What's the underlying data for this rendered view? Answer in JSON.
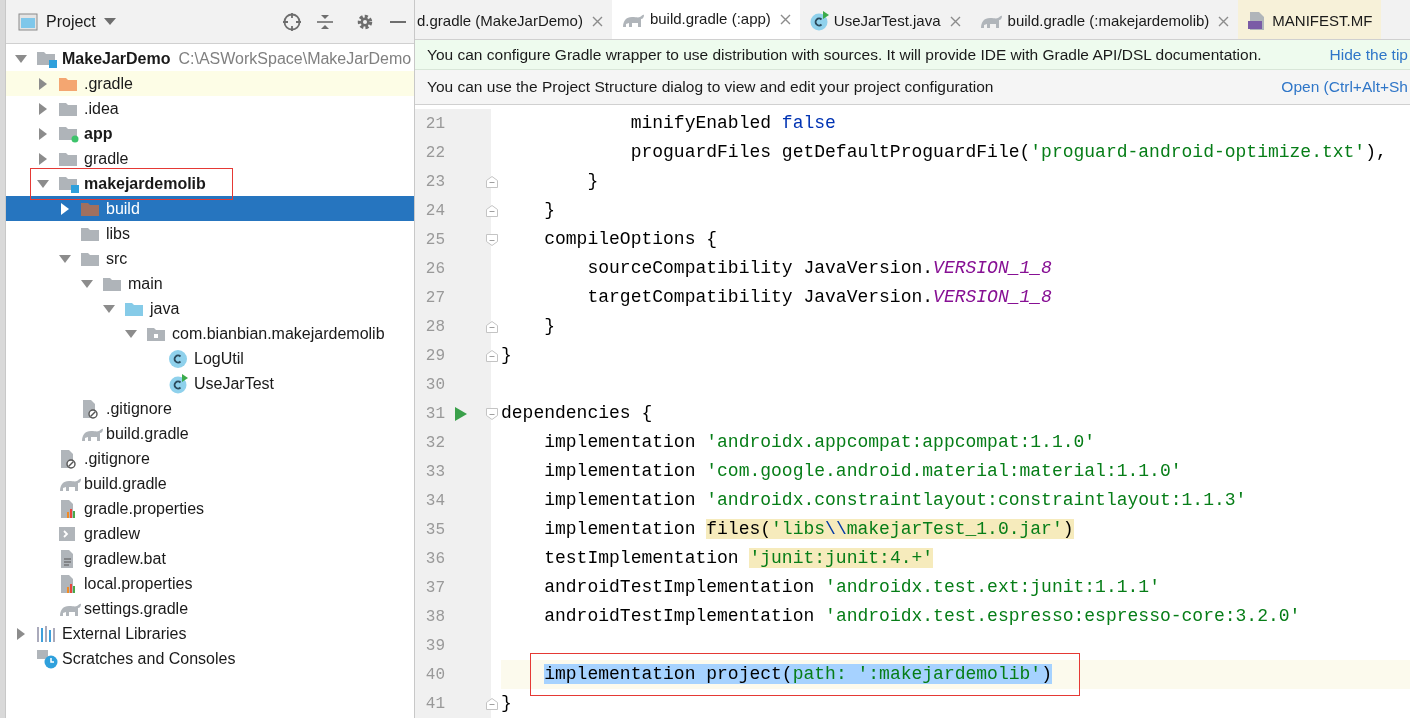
{
  "project_panel": {
    "title": "Project",
    "tree": [
      {
        "label": "MakeJarDemo",
        "hint": "C:\\ASWorkSpace\\MakeJarDemo",
        "kind": "module",
        "bold": true,
        "expanded": true,
        "selected": false,
        "children": [
          {
            "label": ".gradle",
            "kind": "folder-orange",
            "expanded": false,
            "selected": false,
            "highlighted": true
          },
          {
            "label": ".idea",
            "kind": "folder",
            "expanded": false,
            "selected": false
          },
          {
            "label": "app",
            "kind": "module-app",
            "bold": true,
            "expanded": false,
            "selected": false
          },
          {
            "label": "gradle",
            "kind": "folder",
            "expanded": false,
            "selected": false
          },
          {
            "label": "makejardemolib",
            "kind": "module",
            "bold": true,
            "expanded": true,
            "selected": false,
            "annotated": true,
            "children": [
              {
                "label": "build",
                "kind": "folder-build",
                "expanded": false,
                "selected": true
              },
              {
                "label": "libs",
                "kind": "folder",
                "selected": false
              },
              {
                "label": "src",
                "kind": "folder",
                "expanded": true,
                "selected": false,
                "children": [
                  {
                    "label": "main",
                    "kind": "folder",
                    "expanded": true,
                    "selected": false,
                    "children": [
                      {
                        "label": "java",
                        "kind": "folder-source",
                        "expanded": true,
                        "selected": false,
                        "children": [
                          {
                            "label": "com.bianbian.makejardemolib",
                            "kind": "package",
                            "expanded": true,
                            "selected": false,
                            "children": [
                              {
                                "label": "LogUtil",
                                "kind": "class",
                                "selected": false
                              },
                              {
                                "label": "UseJarTest",
                                "kind": "class-run",
                                "selected": false
                              }
                            ]
                          }
                        ]
                      }
                    ]
                  }
                ]
              },
              {
                "label": ".gitignore",
                "kind": "ignore-file",
                "selected": false
              },
              {
                "label": "build.gradle",
                "kind": "gradle",
                "selected": false
              }
            ]
          },
          {
            "label": ".gitignore",
            "kind": "ignore-file",
            "selected": false
          },
          {
            "label": "build.gradle",
            "kind": "gradle",
            "selected": false
          },
          {
            "label": "gradle.properties",
            "kind": "properties",
            "selected": false
          },
          {
            "label": "gradlew",
            "kind": "script",
            "selected": false
          },
          {
            "label": "gradlew.bat",
            "kind": "text-file",
            "selected": false
          },
          {
            "label": "local.properties",
            "kind": "properties",
            "selected": false
          },
          {
            "label": "settings.gradle",
            "kind": "gradle",
            "selected": false
          }
        ]
      },
      {
        "label": "External Libraries",
        "kind": "libraries",
        "expanded": false,
        "selected": false
      },
      {
        "label": "Scratches and Consoles",
        "kind": "scratches",
        "selected": false
      }
    ]
  },
  "tabs": [
    {
      "label": "d.gradle (MakeJarDemo)",
      "kind": "none",
      "selected": false,
      "closable": true
    },
    {
      "label": "build.gradle (:app)",
      "kind": "gradle",
      "selected": true,
      "closable": true
    },
    {
      "label": "UseJarTest.java",
      "kind": "class-run",
      "selected": false,
      "closable": true
    },
    {
      "label": "build.gradle (:makejardemolib)",
      "kind": "gradle",
      "selected": false,
      "closable": true
    },
    {
      "label": "MANIFEST.MF",
      "kind": "manifest",
      "selected": false,
      "closable": false
    }
  ],
  "notices": [
    {
      "kind": "tip",
      "text": "You can configure Gradle wrapper to use distribution with sources. It will provide IDE with Gradle API/DSL documentation.",
      "link": "Hide the tip"
    },
    {
      "kind": "info",
      "text": "You can use the Project Structure dialog to view and edit your project configuration",
      "link": "Open (Ctrl+Alt+Sh"
    }
  ],
  "editor": {
    "lines": [
      {
        "number": "21",
        "tokens": [
          {
            "text": "            minifyEnabled ",
            "kind": "plain"
          },
          {
            "text": "false",
            "kind": "keyword"
          }
        ]
      },
      {
        "number": "22",
        "tokens": [
          {
            "text": "            proguardFiles getDefaultProguardFile(",
            "kind": "plain"
          },
          {
            "text": "'proguard-android-optimize.txt'",
            "kind": "string"
          },
          {
            "text": "),",
            "kind": "plain"
          }
        ]
      },
      {
        "number": "23",
        "fold_end": true,
        "tokens": [
          {
            "text": "        }",
            "kind": "plain"
          }
        ]
      },
      {
        "number": "24",
        "fold_end": true,
        "tokens": [
          {
            "text": "    }",
            "kind": "plain"
          }
        ]
      },
      {
        "number": "25",
        "fold_start": true,
        "tokens": [
          {
            "text": "    compileOptions {",
            "kind": "plain"
          }
        ]
      },
      {
        "number": "26",
        "tokens": [
          {
            "text": "        sourceCompatibility JavaVersion.",
            "kind": "plain"
          },
          {
            "text": "VERSION_1_8",
            "kind": "constant"
          }
        ]
      },
      {
        "number": "27",
        "tokens": [
          {
            "text": "        targetCompatibility JavaVersion.",
            "kind": "plain"
          },
          {
            "text": "VERSION_1_8",
            "kind": "constant"
          }
        ]
      },
      {
        "number": "28",
        "fold_end": true,
        "tokens": [
          {
            "text": "    }",
            "kind": "plain"
          }
        ]
      },
      {
        "number": "29",
        "fold_end": true,
        "tokens": [
          {
            "text": "}",
            "kind": "plain"
          }
        ]
      },
      {
        "number": "30"
      },
      {
        "number": "31",
        "fold_start": true,
        "run": true,
        "tokens": [
          {
            "text": "dependencies {",
            "kind": "plain"
          }
        ]
      },
      {
        "number": "32",
        "tokens": [
          {
            "text": "    implementation ",
            "kind": "plain"
          },
          {
            "text": "'androidx.appcompat:appcompat:1.1.0'",
            "kind": "string"
          }
        ]
      },
      {
        "number": "33",
        "tokens": [
          {
            "text": "    implementation ",
            "kind": "plain"
          },
          {
            "text": "'com.google.android.material:material:1.1.0'",
            "kind": "string"
          }
        ]
      },
      {
        "number": "34",
        "tokens": [
          {
            "text": "    implementation ",
            "kind": "plain"
          },
          {
            "text": "'androidx.constraintlayout:constraintlayout:1.1.3'",
            "kind": "string"
          }
        ]
      },
      {
        "number": "35",
        "tokens": [
          {
            "text": "    implementation ",
            "kind": "plain"
          },
          {
            "text": "files(",
            "kind": "plain",
            "usage_highlight": true
          },
          {
            "text": "'libs",
            "kind": "string",
            "usage_highlight": true
          },
          {
            "text": "\\\\",
            "kind": "escape",
            "usage_highlight": true
          },
          {
            "text": "makejarTest_1.0.jar'",
            "kind": "string",
            "usage_highlight": true
          },
          {
            "text": ")",
            "kind": "plain",
            "usage_highlight": true
          }
        ]
      },
      {
        "number": "36",
        "tokens": [
          {
            "text": "    testImplementation ",
            "kind": "plain"
          },
          {
            "text": "'junit:junit:4.+'",
            "kind": "string",
            "usage_highlight": true
          }
        ]
      },
      {
        "number": "37",
        "tokens": [
          {
            "text": "    androidTestImplementation ",
            "kind": "plain"
          },
          {
            "text": "'androidx.test.ext:junit:1.1.1'",
            "kind": "string"
          }
        ]
      },
      {
        "number": "38",
        "tokens": [
          {
            "text": "    androidTestImplementation ",
            "kind": "plain"
          },
          {
            "text": "'androidx.test.espresso:espresso-core:3.2.0'",
            "kind": "string"
          }
        ]
      },
      {
        "number": "39"
      },
      {
        "number": "40",
        "current": true,
        "annotated": true,
        "tokens": [
          {
            "text": "    implementation project(",
            "kind": "plain",
            "selected": true
          },
          {
            "text": "path: ",
            "kind": "string",
            "selected": true
          },
          {
            "text": "':makejardemolib'",
            "kind": "string",
            "selected": true
          },
          {
            "text": ")",
            "kind": "plain",
            "selected": true
          }
        ]
      },
      {
        "number": "41",
        "fold_end": true,
        "tokens": [
          {
            "text": "}",
            "kind": "plain"
          }
        ]
      }
    ]
  }
}
